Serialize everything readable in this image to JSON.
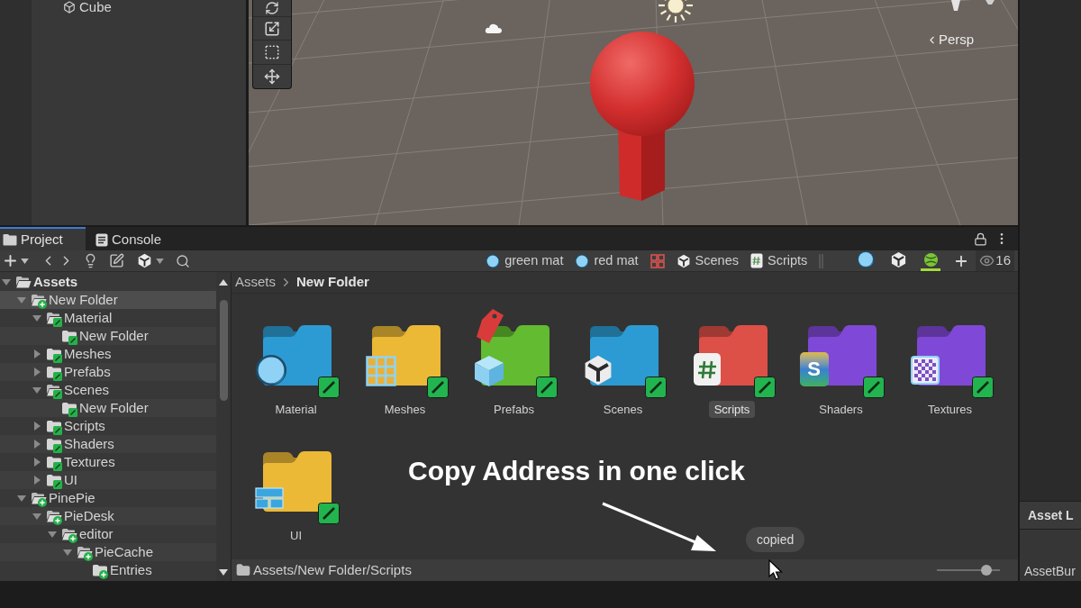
{
  "hierarchy": {
    "items": [
      {
        "label": "Cube"
      }
    ]
  },
  "scene_view": {
    "projection": "Persp"
  },
  "project_window": {
    "tabs": [
      {
        "label": "Project",
        "selected": true
      },
      {
        "label": "Console",
        "selected": false
      }
    ],
    "favorites": [
      {
        "kind": "material",
        "label": "green mat"
      },
      {
        "kind": "material",
        "label": "red mat"
      },
      {
        "kind": "grid"
      },
      {
        "kind": "scene",
        "label": "Scenes"
      },
      {
        "kind": "script",
        "label": "Scripts"
      }
    ],
    "filters": [
      {
        "kind": "material",
        "on": false
      },
      {
        "kind": "scene",
        "on": false
      },
      {
        "kind": "ball",
        "on": true
      }
    ],
    "visible_count": "16",
    "tree": [
      {
        "label": "Assets",
        "kind": "root",
        "expanded": true,
        "selected": false,
        "children": [
          {
            "label": "New Folder",
            "kind": "added",
            "expanded": true,
            "selected": true,
            "children": [
              {
                "label": "Material",
                "kind": "edited",
                "expanded": true,
                "selected": false,
                "children": [
                  {
                    "label": "New Folder",
                    "kind": "edited",
                    "selected": false
                  }
                ]
              },
              {
                "label": "Meshes",
                "kind": "edited",
                "expanded": false,
                "selected": false
              },
              {
                "label": "Prefabs",
                "kind": "edited",
                "expanded": false,
                "selected": false
              },
              {
                "label": "Scenes",
                "kind": "edited",
                "expanded": true,
                "selected": false,
                "children": [
                  {
                    "label": "New Folder",
                    "kind": "edited",
                    "selected": false
                  }
                ]
              },
              {
                "label": "Scripts",
                "kind": "edited",
                "expanded": false,
                "selected": false
              },
              {
                "label": "Shaders",
                "kind": "edited",
                "expanded": false,
                "selected": false
              },
              {
                "label": "Textures",
                "kind": "edited",
                "expanded": false,
                "selected": false
              },
              {
                "label": "UI",
                "kind": "edited",
                "expanded": false,
                "selected": false
              }
            ]
          },
          {
            "label": "PinePie",
            "kind": "added",
            "expanded": true,
            "selected": false,
            "children": [
              {
                "label": "PieDesk",
                "kind": "added",
                "expanded": true,
                "selected": false,
                "children": [
                  {
                    "label": "editor",
                    "kind": "added",
                    "expanded": true,
                    "selected": false,
                    "children": [
                      {
                        "label": "PieCache",
                        "kind": "added",
                        "expanded": true,
                        "selected": false,
                        "children": [
                          {
                            "label": "Entries",
                            "kind": "added",
                            "selected": false
                          }
                        ]
                      }
                    ]
                  }
                ]
              }
            ]
          }
        ]
      }
    ],
    "breadcrumb": [
      "Assets",
      "New Folder"
    ],
    "folders": [
      {
        "label": "Material",
        "color": "#2d9bd3",
        "kind": "material",
        "labeled": false,
        "selected": false
      },
      {
        "label": "Meshes",
        "color": "#ebb936",
        "kind": "mesh",
        "labeled": false,
        "selected": false
      },
      {
        "label": "Prefabs",
        "color": "#62bb30",
        "kind": "prefab",
        "labeled": true,
        "selected": false
      },
      {
        "label": "Scenes",
        "color": "#2d9bd3",
        "kind": "scene",
        "labeled": false,
        "selected": false
      },
      {
        "label": "Scripts",
        "color": "#dd5047",
        "kind": "script",
        "labeled": false,
        "selected": true
      },
      {
        "label": "Shaders",
        "color": "#8048d6",
        "kind": "shader",
        "glyph": "S",
        "labeled": false,
        "selected": false
      },
      {
        "label": "Textures",
        "color": "#8048d6",
        "kind": "texture",
        "labeled": false,
        "selected": false
      },
      {
        "label": "UI",
        "color": "#ebb936",
        "kind": "ui",
        "labeled": false,
        "selected": false
      }
    ],
    "status_path": "Assets/New Folder/Scripts",
    "zoom_slider": {
      "level": 0.78
    }
  },
  "right_panel": {
    "header": "Asset L",
    "row": "AssetBur"
  },
  "annotation": {
    "caption": "Copy Address in one click",
    "tooltip": "copied"
  }
}
